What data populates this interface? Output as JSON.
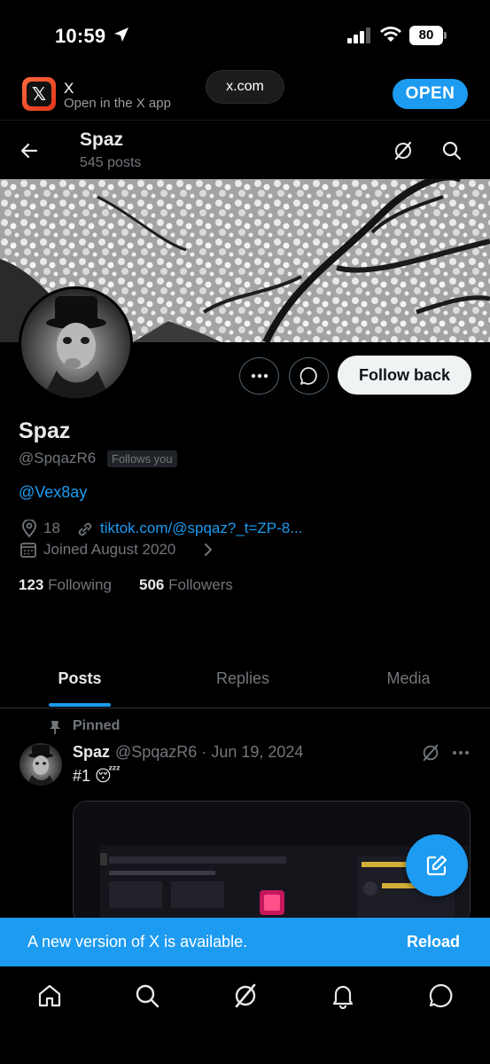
{
  "status_bar": {
    "time": "10:59",
    "battery": "80"
  },
  "app_banner": {
    "app_name": "X",
    "subtitle": "Open in the X app",
    "url": "x.com",
    "open_label": "OPEN"
  },
  "header": {
    "name": "Spaz",
    "post_count": "545 posts"
  },
  "profile": {
    "name": "Spaz",
    "handle": "@SpqazR6",
    "follows_badge": "Follows you",
    "bio": "@Vex8ay",
    "location": "18",
    "link": "tiktok.com/@spqaz?_t=ZP-8...",
    "joined": "Joined August 2020",
    "following_count": "123",
    "following_label": "Following",
    "followers_count": "506",
    "followers_label": "Followers",
    "follow_button": "Follow back"
  },
  "tabs": [
    {
      "label": "Posts",
      "active": true
    },
    {
      "label": "Replies",
      "active": false
    },
    {
      "label": "Media",
      "active": false
    }
  ],
  "pinned_post": {
    "pinned_label": "Pinned",
    "author": "Spaz",
    "meta": "@SpqazR6 · Jun 19, 2024",
    "text": "#1 😴"
  },
  "update_bar": {
    "message": "A new version of X is available.",
    "reload_label": "Reload"
  },
  "colors": {
    "accent": "#1d9bf0",
    "background": "#000000",
    "muted": "#71767b"
  }
}
